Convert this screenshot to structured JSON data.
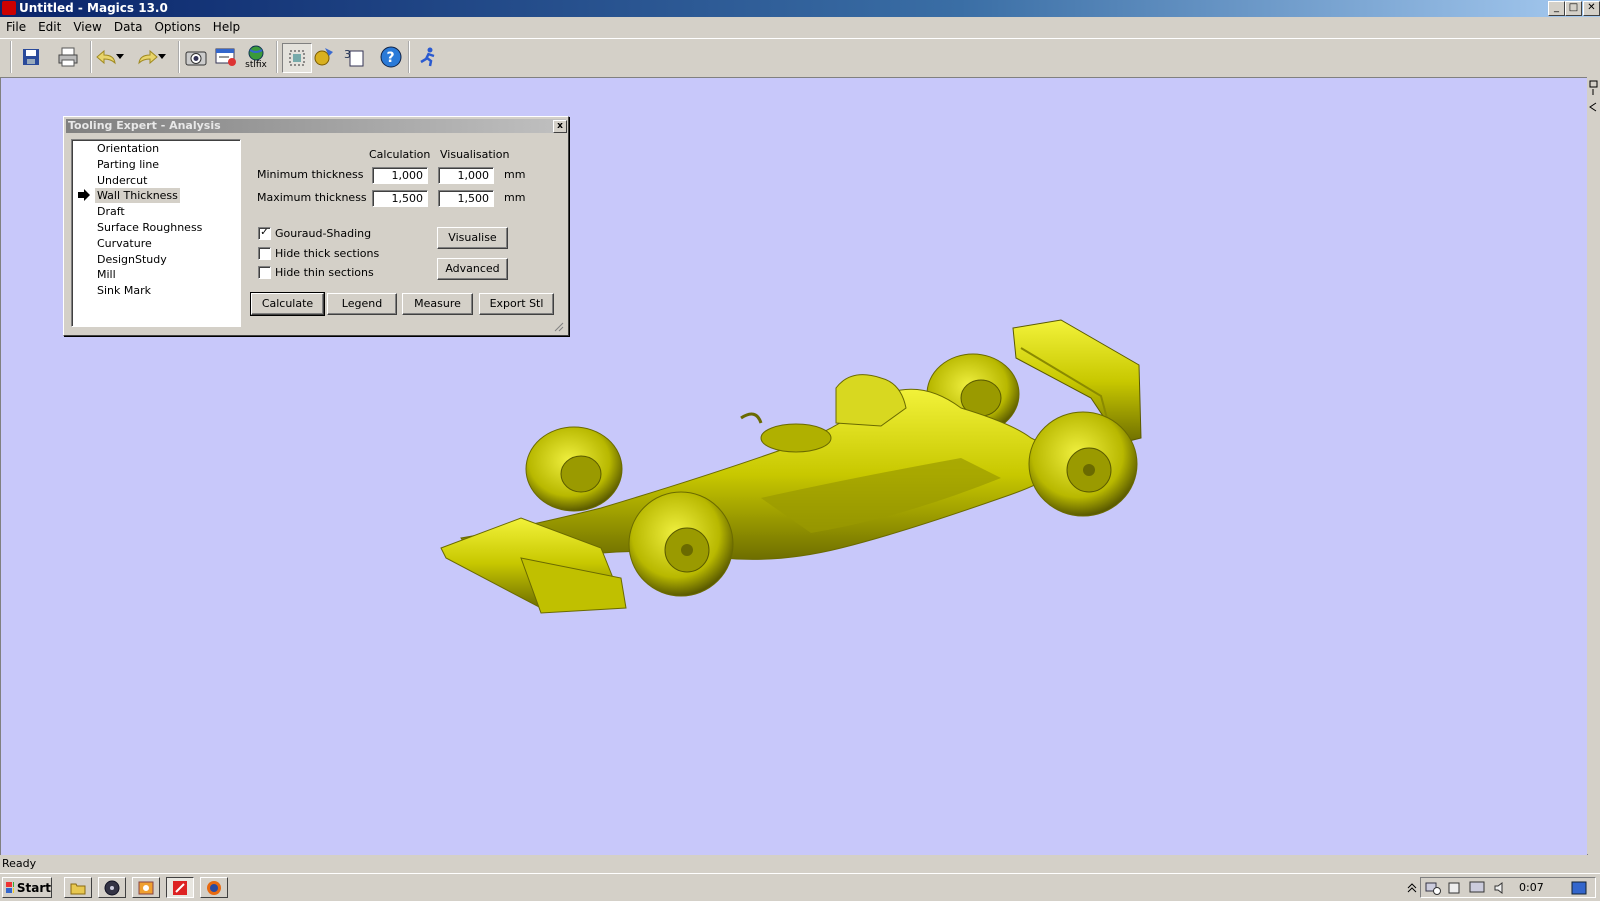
{
  "window": {
    "title": "Untitled - Magics 13.0",
    "controls": {
      "minimize": "_",
      "maximize": "□",
      "close": "✕"
    }
  },
  "menu": [
    "File",
    "Edit",
    "View",
    "Data",
    "Options",
    "Help"
  ],
  "toolbar": {
    "stlfix_label": "stlfix",
    "icons": [
      "save-icon",
      "print-icon",
      "undo-icon",
      "redo-icon",
      "camera-icon",
      "report-icon",
      "stlfix-icon",
      "select-icon",
      "tooling-icon",
      "3d-page-icon",
      "help-icon",
      "run-icon"
    ]
  },
  "dialog": {
    "title": "Tooling Expert - Analysis",
    "close": "x",
    "list": [
      "Orientation",
      "Parting line",
      "Undercut",
      "Wall Thickness",
      "Draft",
      "Surface Roughness",
      "Curvature",
      "DesignStudy",
      "Mill",
      "Sink Mark"
    ],
    "selected": "Wall Thickness",
    "headers": {
      "calculation": "Calculation",
      "visualisation": "Visualisation"
    },
    "rows": [
      {
        "label": "Minimum thickness",
        "calc": "1,000",
        "vis": "1,000",
        "unit": "mm"
      },
      {
        "label": "Maximum thickness",
        "calc": "1,500",
        "vis": "1,500",
        "unit": "mm"
      }
    ],
    "checkboxes": [
      {
        "label": "Gouraud-Shading",
        "checked": true
      },
      {
        "label": "Hide thick sections",
        "checked": false
      },
      {
        "label": "Hide thin sections",
        "checked": false
      }
    ],
    "buttons": {
      "visualise": "Visualise",
      "advanced": "Advanced",
      "calculate": "Calculate",
      "legend": "Legend",
      "measure": "Measure",
      "export": "Export Stl"
    }
  },
  "viewport": {
    "background": "#c8c8fa",
    "model_color": "#c8c800"
  },
  "status": "Ready",
  "taskbar": {
    "start": "Start",
    "clock": "0:07"
  }
}
